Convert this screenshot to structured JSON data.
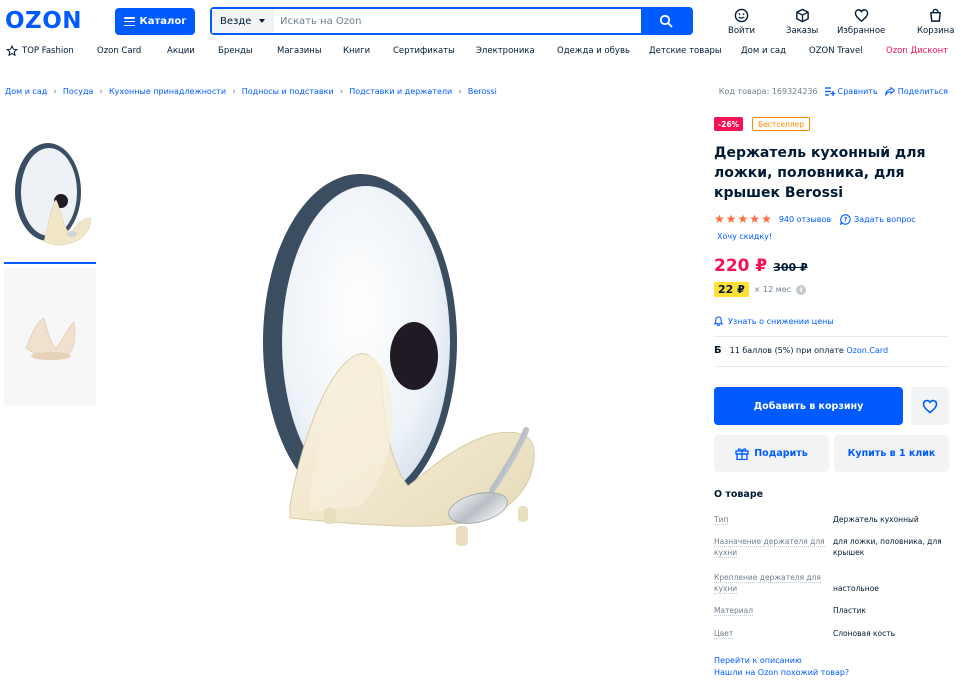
{
  "header": {
    "logo": "OZON",
    "catalog_label": "Каталог",
    "search": {
      "scope": "Везде",
      "placeholder": "Искать на Ozon",
      "value": ""
    },
    "icons": [
      {
        "name": "login",
        "label": "Войти"
      },
      {
        "name": "orders",
        "label": "Заказы"
      },
      {
        "name": "favorites",
        "label": "Избранное"
      },
      {
        "name": "cart",
        "label": "Корзина"
      }
    ]
  },
  "nav": {
    "items": [
      "TOP Fashion",
      "Ozon Card",
      "Акции",
      "Бренды",
      "Магазины",
      "Книги",
      "Сертификаты",
      "Электроника",
      "Одежда и обувь",
      "Детские товары",
      "Дом и сад",
      "OZON Travel",
      "Ozon Дисконт"
    ],
    "highlight_color": "#f91155"
  },
  "breadcrumb": [
    "Дом и сад",
    "Посуда",
    "Кухонные принадлежности",
    "Подносы и подставки",
    "Подставки и держатели",
    "Berossi"
  ],
  "meta": {
    "code": "Код товара: 169324236",
    "compare": "Сравнить",
    "share": "Поделиться"
  },
  "product": {
    "badge_discount": "-26%",
    "badge_best": "Бестселлер",
    "title": "Держатель кухонный для ложки, половника, для крышек Berossi",
    "rating": 5,
    "reviews": "940 отзывов",
    "ask": "Задать вопрос",
    "want_discount": "Хочу скидку!",
    "price": "220 ₽",
    "old_price": "300 ₽",
    "installment_amount": "22 ₽",
    "installment_term": "× 12 мес",
    "notify": "Узнать о снижении цены",
    "bonus_letter": "Б",
    "bonus_text": "11 баллов (5%) при оплате",
    "bonus_link": "Ozon.Card",
    "add_to_cart": "Добавить в корзину",
    "gift": "Подарить",
    "one_click": "Купить в 1 клик"
  },
  "about": {
    "title": "О товаре",
    "specs": [
      {
        "key": "Тип",
        "value": "Держатель кухонный"
      },
      {
        "key": "Назначение держателя для кухни",
        "value": "для ложки, половника, для крышек"
      },
      {
        "key": "Крепление держателя для кухни",
        "value": "настольное"
      },
      {
        "key": "Материал",
        "value": "Пластик"
      },
      {
        "key": "Цвет",
        "value": "Слоновая кость"
      }
    ],
    "go_to_description": "Перейти к описанию",
    "found_cheaper": "Нашли на Ozon похожий товар?"
  },
  "colors": {
    "brand": "#005bff",
    "sale": "#f91155",
    "bestseller": "#ff8a00",
    "installment": "#ffe033",
    "star": "#ff6b3d"
  }
}
